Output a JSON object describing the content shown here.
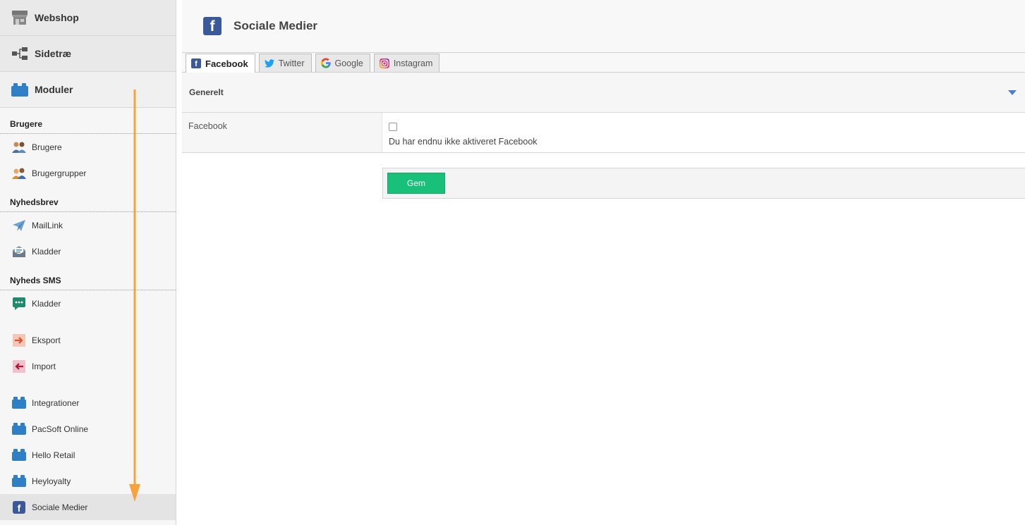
{
  "sidebar": {
    "top_nav": [
      {
        "label": "Webshop",
        "icon": "shop-icon"
      },
      {
        "label": "Sidetræ",
        "icon": "sitemap-icon"
      },
      {
        "label": "Moduler",
        "icon": "module-icon"
      }
    ],
    "groups": {
      "brugere": {
        "title": "Brugere",
        "items": [
          {
            "label": "Brugere",
            "icon": "users-icon"
          },
          {
            "label": "Brugergrupper",
            "icon": "user-groups-icon"
          }
        ]
      },
      "nyhedsbrev": {
        "title": "Nyhedsbrev",
        "items": [
          {
            "label": "MailLink",
            "icon": "paper-plane-icon"
          },
          {
            "label": "Kladder",
            "icon": "envelope-open-icon"
          }
        ]
      },
      "nyheds_sms": {
        "title": "Nyheds SMS",
        "items": [
          {
            "label": "Kladder",
            "icon": "sms-bubble-icon"
          }
        ]
      }
    },
    "io_items": [
      {
        "label": "Eksport",
        "icon": "export-arrow-icon"
      },
      {
        "label": "Import",
        "icon": "import-arrow-icon"
      }
    ],
    "module_items": [
      {
        "label": "Integrationer",
        "icon": "module-icon"
      },
      {
        "label": "PacSoft Online",
        "icon": "module-icon"
      },
      {
        "label": "Hello Retail",
        "icon": "module-icon"
      },
      {
        "label": "Heyloyalty",
        "icon": "module-icon"
      },
      {
        "label": "Sociale Medier",
        "icon": "facebook-icon"
      }
    ]
  },
  "main": {
    "page_title": "Sociale Medier",
    "tabs": [
      {
        "label": "Facebook",
        "icon": "facebook-icon",
        "active": true
      },
      {
        "label": "Twitter",
        "icon": "twitter-icon"
      },
      {
        "label": "Google",
        "icon": "google-icon"
      },
      {
        "label": "Instagram",
        "icon": "instagram-icon"
      }
    ],
    "section": {
      "title": "Generelt"
    },
    "form": {
      "facebook_label": "Facebook",
      "facebook_hint": "Du har endnu ikke aktiveret Facebook"
    },
    "save_label": "Gem"
  },
  "colors": {
    "accent_button": "#18c07a",
    "facebook": "#3b5998",
    "module_blue": "#2f7fc7",
    "annotation_arrow": "#f5a33a"
  }
}
